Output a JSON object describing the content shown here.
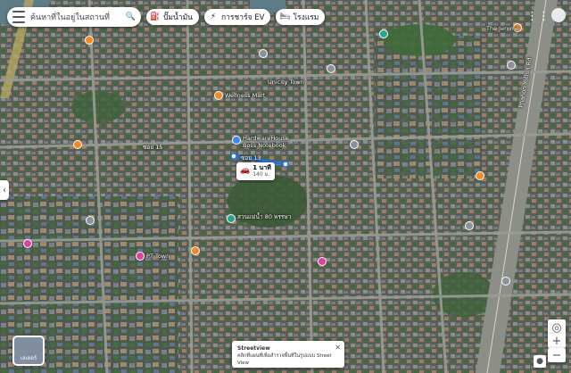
{
  "search": {
    "query": "ค้นหาที่ในอยู่ในสถานที่",
    "menu_icon": "hamburger-menu-icon"
  },
  "chips": [
    {
      "label": "ปั๊มน้ำมัน",
      "icon": "gas-station-icon"
    },
    {
      "label": "การชาร์จ EV",
      "icon": "ev-charger-icon"
    },
    {
      "label": "โรงแรม",
      "icon": "hotel-icon"
    }
  ],
  "header_icons": [
    "apps-grid-icon",
    "account-avatar"
  ],
  "route": {
    "time": "1 นาที",
    "distance": "140 ม."
  },
  "labels": {
    "hardware": "HardwareHouse",
    "notebook": "Boss Notebook",
    "soi13": "ซอย 13",
    "soi15": "ซอย 15",
    "park": "สวนแม่น้ำ 80 พรรษา",
    "unicity": "Unicity Town",
    "pt_town": "PT Town",
    "jerome": "The Jerome",
    "phahon": "Phahon Yothin Rd",
    "wm": "Wellness Mart"
  },
  "layers_label": "เลเยอร์",
  "toast": {
    "title": "Streetview",
    "body": "คลิกที่แผนที่เพื่อสำรวจพื้นที่ในรูปแบบ Street View"
  },
  "colors": {
    "route": "#1a73e8",
    "pin_red": "#e8453c",
    "pin_orange": "#f28b24",
    "pin_pink": "#e040a0",
    "pin_grey": "#8a939c",
    "pin_teal": "#27a78a"
  }
}
